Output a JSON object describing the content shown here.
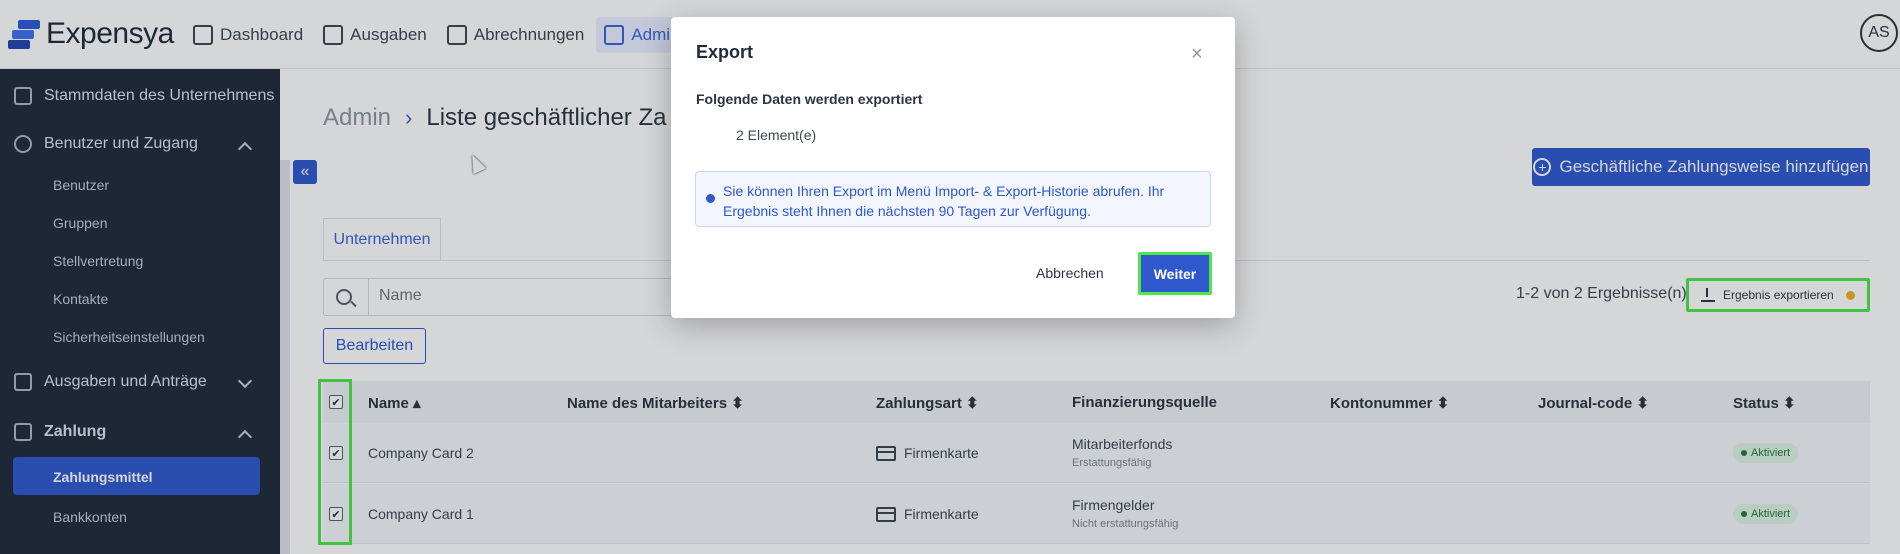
{
  "app": {
    "name": "Expensya",
    "user_initials": "AS"
  },
  "nav": {
    "items": [
      {
        "label": "Dashboard",
        "icon": "chart-icon"
      },
      {
        "label": "Ausgaben",
        "icon": "receipt-icon"
      },
      {
        "label": "Abrechnungen",
        "icon": "folder-icon"
      },
      {
        "label": "Admin",
        "icon": "admin-icon",
        "active": true
      }
    ]
  },
  "sidebar": {
    "sections": [
      {
        "label": "Stammdaten des Unternehmens"
      },
      {
        "label": "Benutzer und Zugang",
        "expanded": true
      },
      {
        "label": "Ausgaben und Anträge",
        "expanded": false
      },
      {
        "label": "Zahlung",
        "expanded": true
      }
    ],
    "sub_items": {
      "benutzer": [
        "Benutzer",
        "Gruppen",
        "Stellvertretung",
        "Kontakte",
        "Sicherheitseinstellungen"
      ],
      "zahlung": [
        "Zahlungsmittel",
        "Bankkonten"
      ]
    }
  },
  "page": {
    "breadcrumb_root": "Admin",
    "breadcrumb_separator": "›",
    "title": "Liste geschäftlicher Za",
    "add_button": "Geschäftliche Zahlungsweise hinzufügen",
    "tab": "Unternehmen",
    "search_placeholder": "Name",
    "edit_button": "Bearbeiten",
    "results_text": "1-2 von 2 Ergebnisse(n)",
    "export_button": "Ergebnis exportieren"
  },
  "table": {
    "headers": [
      "Name",
      "Name des Mitarbeiters",
      "Zahlungsart",
      "Finanzierungsquelle",
      "Kontonummer",
      "Journal-code",
      "Status"
    ],
    "rows": [
      {
        "name": "Company Card 2",
        "payment_type": "Firmenkarte",
        "funding": "Mitarbeiterfonds",
        "funding_sub": "Erstattungsfähig",
        "status": "Aktiviert"
      },
      {
        "name": "Company Card 1",
        "payment_type": "Firmenkarte",
        "funding": "Firmengelder",
        "funding_sub": "Nicht erstattungsfähig",
        "status": "Aktiviert"
      }
    ]
  },
  "modal": {
    "title": "Export",
    "close": "×",
    "label": "Folgende Daten werden exportiert",
    "count": "2 Element(e)",
    "info": "Sie können Ihren Export im Menü Import- & Export-Historie abrufen. Ihr Ergebnis steht Ihnen die nächsten 90 Tagen zur Verfügung.",
    "cancel": "Abbrechen",
    "continue": "Weiter"
  },
  "colors": {
    "primary": "#2f58cf",
    "sidebar": "#1f2a3a",
    "highlight": "#4ee64a",
    "status_green": "#1e7a3c"
  }
}
